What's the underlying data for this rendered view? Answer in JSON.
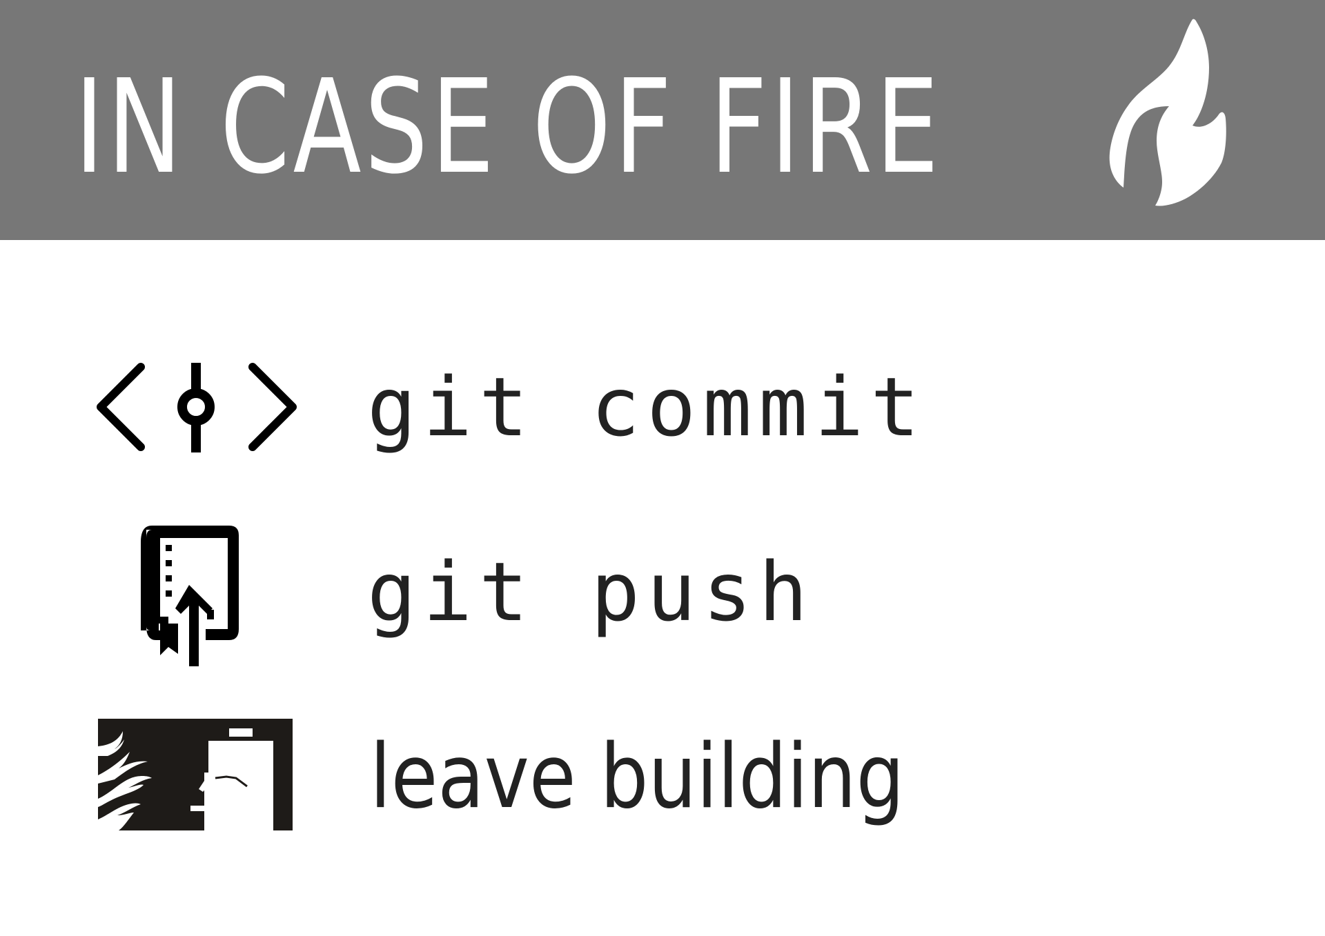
{
  "banner": {
    "title": "IN CASE OF FIRE",
    "icon": "flame-icon",
    "background_color": "#777777",
    "text_color": "#ffffff"
  },
  "steps": [
    {
      "label": "git commit",
      "icon": "git-commit-icon"
    },
    {
      "label": "git push",
      "icon": "git-push-icon"
    },
    {
      "label": "leave building",
      "icon": "emergency-exit-icon"
    }
  ],
  "text_color": "#222222"
}
